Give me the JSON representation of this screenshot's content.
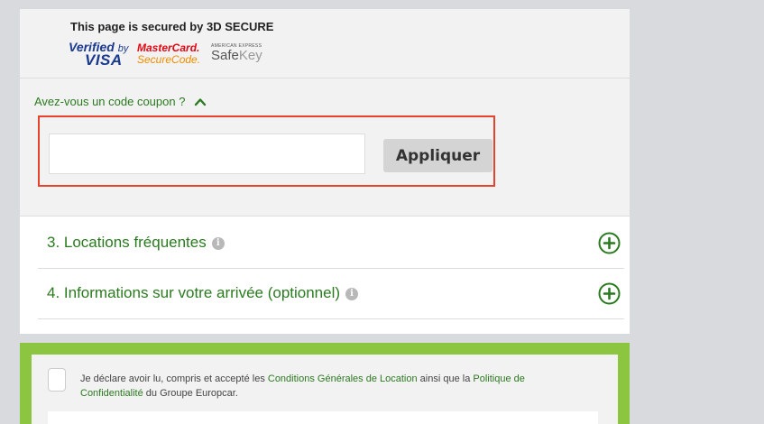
{
  "secure": {
    "title": "This page is secured by 3D SECURE",
    "logos": {
      "visa_verified": "Verified",
      "visa_by": "by",
      "visa": "VISA",
      "mastercard": "MasterCard.",
      "securecode": "SecureCode.",
      "amex_small": "AMERICAN EXPRESS",
      "safe": "Safe",
      "key": "Key"
    }
  },
  "coupon": {
    "toggle_label": "Avez-vous un code coupon ?",
    "input_value": "",
    "input_placeholder": "",
    "apply_label": "Appliquer"
  },
  "sections": [
    {
      "label": "3. Locations fréquentes",
      "icon": "info-icon",
      "action_icon": "plus-circle-icon"
    },
    {
      "label": "4. Informations sur votre arrivée (optionnel)",
      "icon": "info-icon",
      "action_icon": "plus-circle-icon"
    }
  ],
  "terms": {
    "checked": false,
    "text_1": "Je déclare avoir lu, compris et accepté les ",
    "link_1": "Conditions Générales de Location",
    "text_2": " ainsi que la ",
    "link_2": "Politique de Confidentialité",
    "text_3": " du Groupe Europcar."
  },
  "colors": {
    "accent_green": "#2a7a1f",
    "frame_green": "#8cc540",
    "highlight_red": "#e6422c"
  }
}
